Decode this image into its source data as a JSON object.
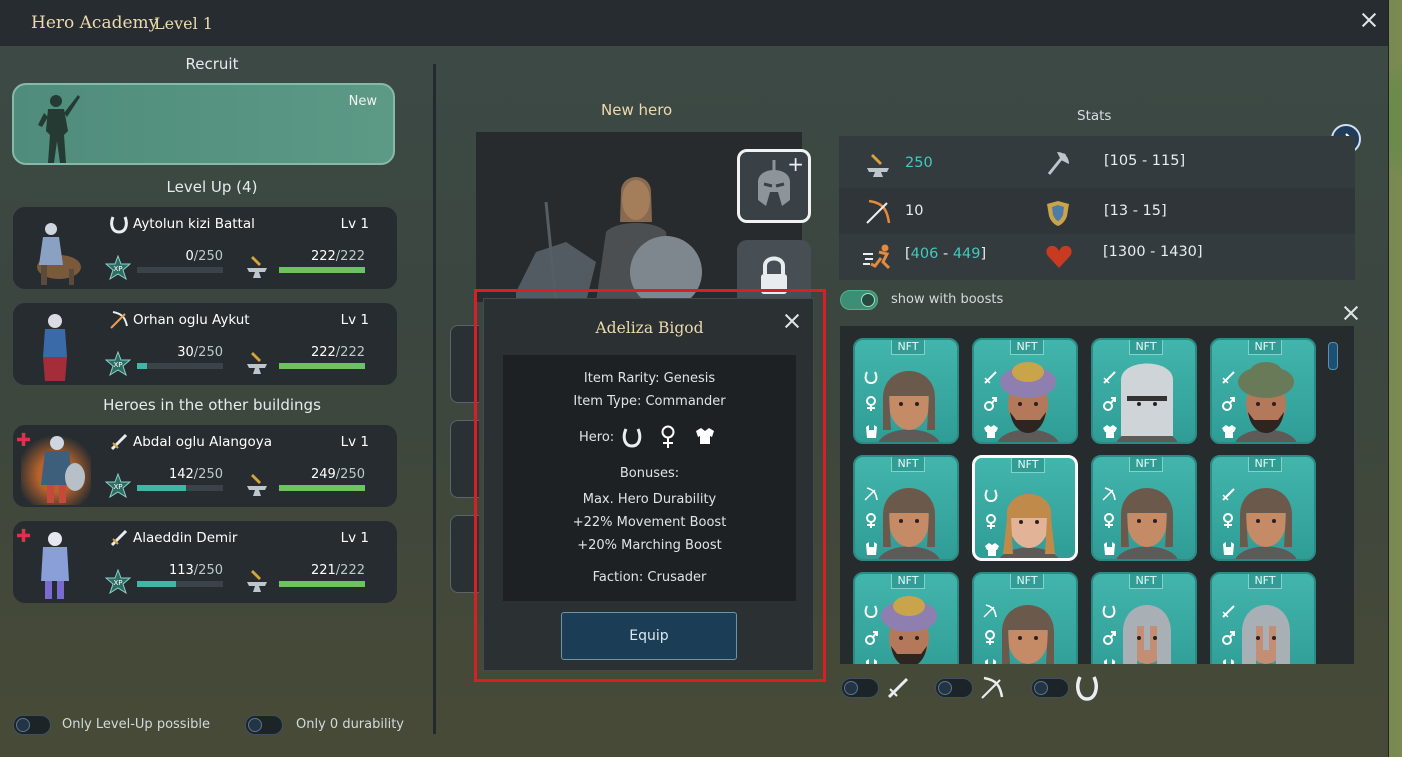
{
  "window": {
    "title": "Hero Academy",
    "level": "Level 1"
  },
  "left": {
    "recruit_heading": "Recruit",
    "recruit_badge": "New",
    "levelup_heading": "Level Up (4)",
    "other_heading": "Heroes in the other buildings",
    "heroes": [
      {
        "name": "Aytolun kizi Battal",
        "lv": "Lv 1",
        "class_icon": "horseshoe-icon",
        "xp": "0",
        "xp_max": "/250",
        "xp_ratio": 0.0,
        "dur": "222",
        "dur_max": "/222",
        "dur_ratio": 1.0
      },
      {
        "name": "Orhan oglu Aykut",
        "lv": "Lv 1",
        "class_icon": "bow-icon",
        "xp": "30",
        "xp_max": "/250",
        "xp_ratio": 0.12,
        "dur": "222",
        "dur_max": "/222",
        "dur_ratio": 1.0
      },
      {
        "name": "Abdal oglu Alangoya",
        "lv": "Lv 1",
        "class_icon": "sword-icon",
        "xp": "142",
        "xp_max": "/250",
        "xp_ratio": 0.57,
        "dur": "249",
        "dur_max": "/250",
        "dur_ratio": 0.996
      },
      {
        "name": "Alaeddin Demir",
        "lv": "Lv 1",
        "class_icon": "sword-icon",
        "xp": "113",
        "xp_max": "/250",
        "xp_ratio": 0.45,
        "dur": "221",
        "dur_max": "/222",
        "dur_ratio": 0.995
      }
    ],
    "xp_badge": "XP",
    "filters": {
      "levelup_label": "Only Level-Up possible",
      "durability_label": "Only 0 durability"
    }
  },
  "center": {
    "new_hero_label": "New hero"
  },
  "popup": {
    "title": "Adeliza Bigod",
    "rarity": "Item Rarity: Genesis",
    "type": "Item Type: Commander",
    "hero_label": "Hero:",
    "bonuses_label": "Bonuses:",
    "bonus_1": "Max. Hero Durability",
    "bonus_2": "+22% Movement Boost",
    "bonus_3": "+20% Marching Boost",
    "faction": "Faction: Crusader",
    "equip": "Equip"
  },
  "stats": {
    "heading": "Stats",
    "attack": "250",
    "attack_range": "[105 - 115]",
    "ranged": "10",
    "defense": "[13 - 15]",
    "speed_open": "[",
    "speed_min": "406",
    "speed_sep": " - ",
    "speed_max": "449",
    "speed_close": "]",
    "health": "[1300 - 1430]",
    "boost_toggle": "show with boosts"
  },
  "items": {
    "nft_label": "NFT",
    "tiles": [
      {
        "cls": "horseshoe",
        "sex": "f",
        "armor": "light",
        "face": "turban-f"
      },
      {
        "cls": "sword",
        "sex": "m",
        "armor": "heavy",
        "face": "bearded-gold"
      },
      {
        "cls": "sword",
        "sex": "m",
        "armor": "heavy",
        "face": "greathelm"
      },
      {
        "cls": "sword",
        "sex": "m",
        "armor": "heavy",
        "face": "bearded-green"
      },
      {
        "cls": "bow",
        "sex": "f",
        "armor": "light",
        "face": "turban-f"
      },
      {
        "cls": "horseshoe",
        "sex": "f",
        "armor": "heavy",
        "face": "blonde-f",
        "selected": true
      },
      {
        "cls": "bow",
        "sex": "f",
        "armor": "light",
        "face": "turban-f"
      },
      {
        "cls": "sword",
        "sex": "f",
        "armor": "light",
        "face": "turban-f"
      },
      {
        "cls": "horseshoe",
        "sex": "m",
        "armor": "light",
        "face": "bearded-gold"
      },
      {
        "cls": "bow",
        "sex": "f",
        "armor": "light",
        "face": "turban-f"
      },
      {
        "cls": "horseshoe",
        "sex": "m",
        "armor": "light",
        "face": "steelhelm"
      },
      {
        "cls": "sword",
        "sex": "m",
        "armor": "light",
        "face": "steelhelm"
      }
    ]
  },
  "colors": {
    "accent_teal": "#43c9bd",
    "gold": "#ecd9ae",
    "highlight_red": "#d81f25",
    "tile_teal": "#3aaca4"
  }
}
